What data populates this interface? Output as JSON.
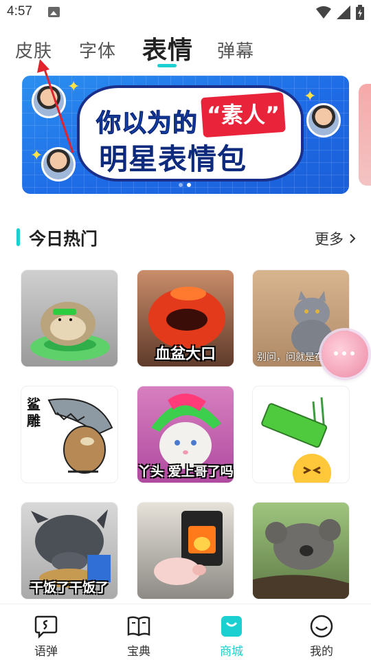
{
  "status_bar": {
    "time": "4:57"
  },
  "top_tabs": [
    {
      "label": "皮肤",
      "active": false
    },
    {
      "label": "字体",
      "active": false
    },
    {
      "label": "表情",
      "active": true
    },
    {
      "label": "弹幕",
      "active": false
    }
  ],
  "banner": {
    "line1": "你以为的",
    "highlight": "“素人”",
    "line2": "明星表情包"
  },
  "section": {
    "title": "今日热门",
    "more": "更多"
  },
  "stickers": [
    {
      "caption": "",
      "icon": "hedgehog-image"
    },
    {
      "caption": "血盆大口",
      "icon": "red-mouth-image"
    },
    {
      "caption": "别问，问就是在",
      "icon": "cat-image"
    },
    {
      "caption": "",
      "vertical_text": "鲨雕",
      "icon": "shark-owl-image"
    },
    {
      "caption": "丫头 爱上哥了吗",
      "icon": "rainbow-wig-cat-image"
    },
    {
      "caption": "",
      "icon": "tired-battery-emoji-image"
    },
    {
      "caption": "干饭了干饭了",
      "icon": "pig-eating-image"
    },
    {
      "caption": "",
      "icon": "piglet-fireplace-image"
    },
    {
      "caption": "",
      "icon": "sleeping-koala-image"
    }
  ],
  "bottom_nav": [
    {
      "label": "语弹",
      "icon": "chat-bubble-icon",
      "active": false
    },
    {
      "label": "宝典",
      "icon": "book-icon",
      "active": false
    },
    {
      "label": "商城",
      "icon": "shop-bag-icon",
      "active": true
    },
    {
      "label": "我的",
      "icon": "smile-face-icon",
      "active": false
    }
  ],
  "colors": {
    "accent": "#1ccfd1",
    "annotation": "#e0232d"
  }
}
